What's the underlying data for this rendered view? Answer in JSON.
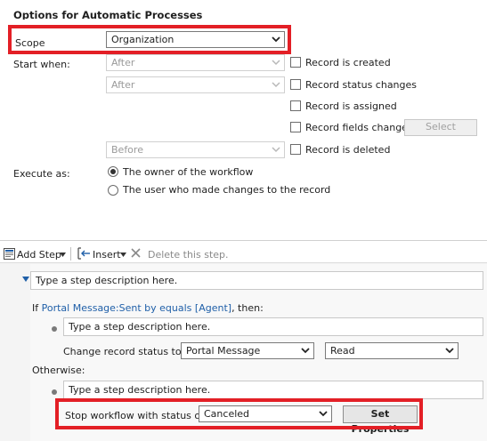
{
  "options": {
    "heading": "Options for Automatic Processes",
    "scope_label": "Scope",
    "scope_value": "Organization",
    "start_when_label": "Start when:",
    "start_after_1": "After",
    "start_after_2": "After",
    "start_before": "Before",
    "record_created": "Record is created",
    "record_status_changes": "Record status changes",
    "record_assigned": "Record is assigned",
    "record_fields_change": "Record fields change",
    "select_button": "Select",
    "record_deleted": "Record is deleted",
    "execute_as_label": "Execute as:",
    "execute_owner": "The owner of the workflow",
    "execute_user": "The user who made changes to the record"
  },
  "toolbar": {
    "add_step": "Add Step",
    "insert": "Insert",
    "delete_step": "Delete this step."
  },
  "steps": {
    "step_placeholder": "Type a step description here.",
    "if_prefix": "If",
    "condition_link": "Portal Message:Sent by equals [Agent]",
    "then_suffix": ", then:",
    "change_status_label": "Change record status to:",
    "change_status_entity": "Portal Message",
    "change_status_value": "Read",
    "otherwise_label": "Otherwise:",
    "stop_label": "Stop workflow with status of:",
    "stop_value": "Canceled",
    "set_properties": "Set Properties"
  },
  "colors": {
    "highlight": "#e31f26",
    "link": "#1f5fa8",
    "editor_background": "#f4f4f4"
  }
}
